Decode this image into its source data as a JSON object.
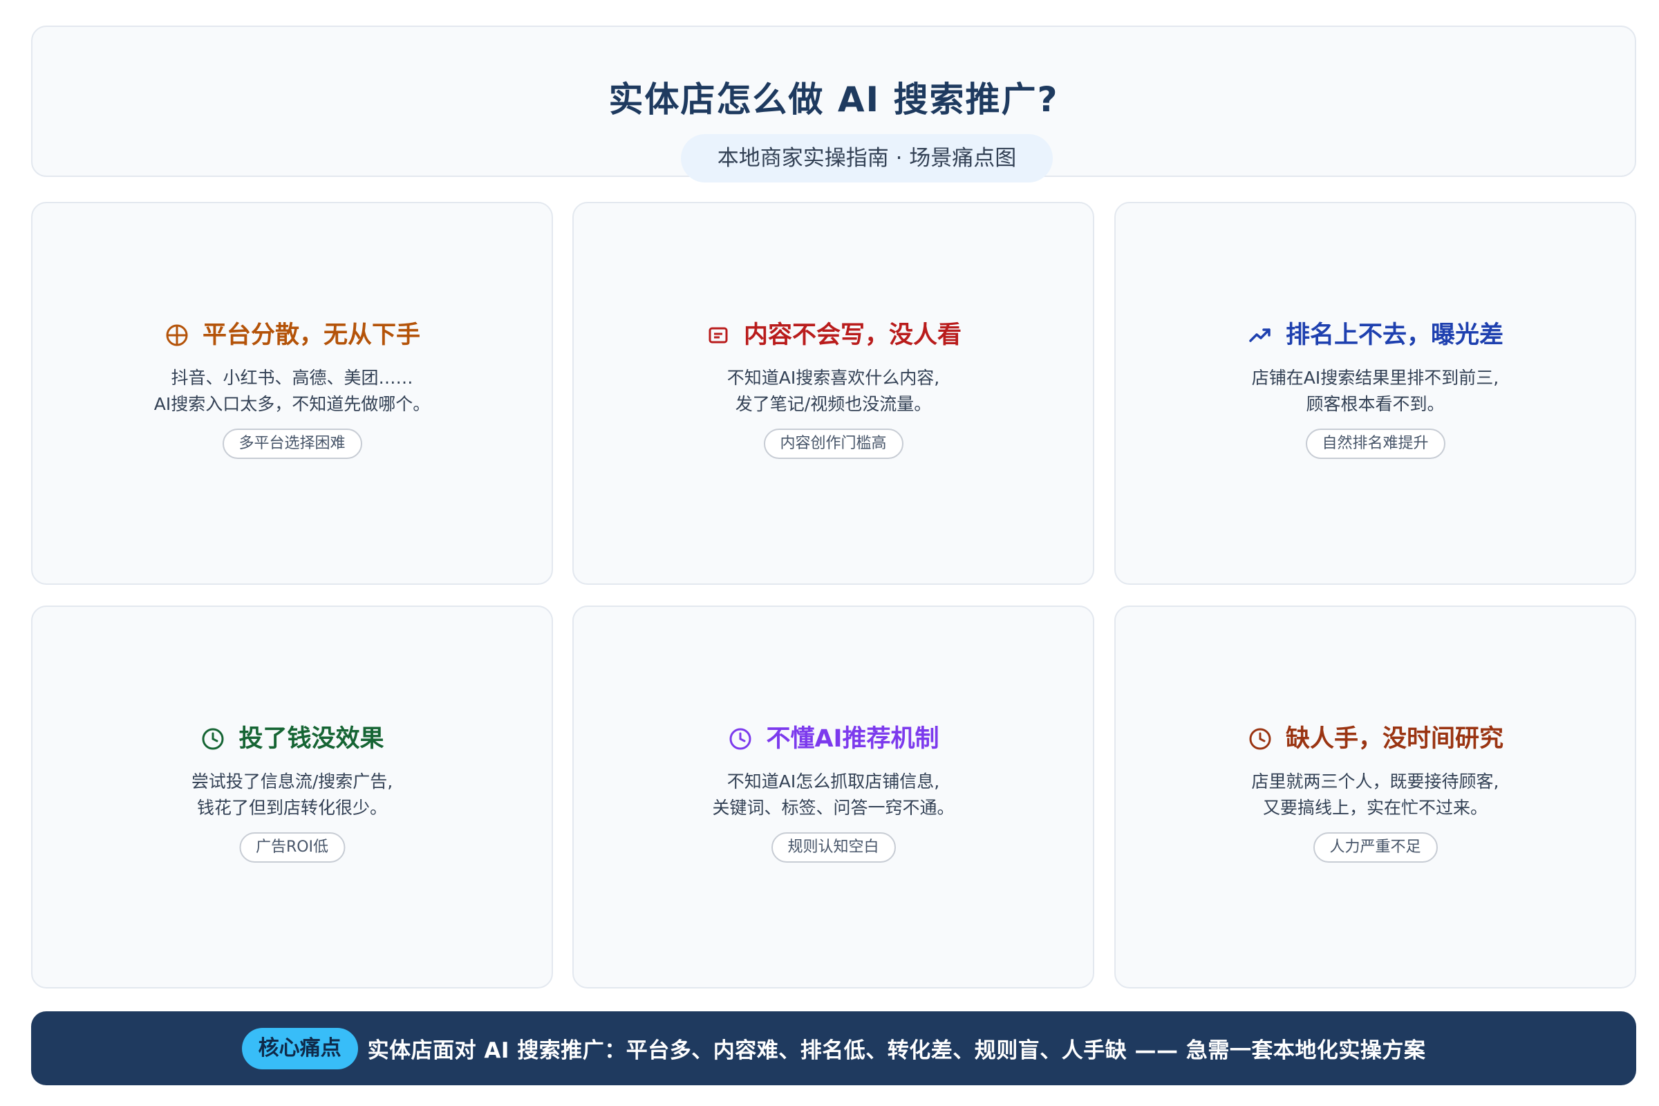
{
  "header": {
    "title": "实体店怎么做 AI 搜索推广?",
    "subtitle": "本地商家实操指南 · 场景痛点图"
  },
  "cards": [
    {
      "title": "平台分散，无从下手",
      "icon": "crosshair-icon",
      "color": "#b45309",
      "desc_line1": "抖音、小红书、高德、美团……",
      "desc_line2": "AI搜索入口太多，不知道先做哪个。",
      "tag": "多平台选择困难"
    },
    {
      "title": "内容不会写，没人看",
      "icon": "document-icon",
      "color": "#b91c1c",
      "desc_line1": "不知道AI搜索喜欢什么内容,",
      "desc_line2": "发了笔记/视频也没流量。",
      "tag": "内容创作门槛高"
    },
    {
      "title": "排名上不去，曝光差",
      "icon": "trending-up-icon",
      "color": "#1e40af",
      "desc_line1": "店铺在AI搜索结果里排不到前三,",
      "desc_line2": "顾客根本看不到。",
      "tag": "自然排名难提升"
    },
    {
      "title": "投了钱没效果",
      "icon": "clock-icon",
      "color": "#166534",
      "desc_line1": "尝试投了信息流/搜索广告,",
      "desc_line2": "钱花了但到店转化很少。",
      "tag": "广告ROI低"
    },
    {
      "title": "不懂AI推荐机制",
      "icon": "clock-icon",
      "color": "#7c3aed",
      "desc_line1": "不知道AI怎么抓取店铺信息,",
      "desc_line2": "关键词、标签、问答一窍不通。",
      "tag": "规则认知空白"
    },
    {
      "title": "缺人手，没时间研究",
      "icon": "clock-icon",
      "color": "#9a3412",
      "desc_line1": "店里就两三个人，既要接待顾客,",
      "desc_line2": "又要搞线上，实在忙不过来。",
      "tag": "人力严重不足"
    }
  ],
  "footer": {
    "badge": "核心痛点",
    "text": "实体店面对 AI 搜索推广：平台多、内容难、排名低、转化差、规则盲、人手缺 —— 急需一套本地化实操方案"
  }
}
